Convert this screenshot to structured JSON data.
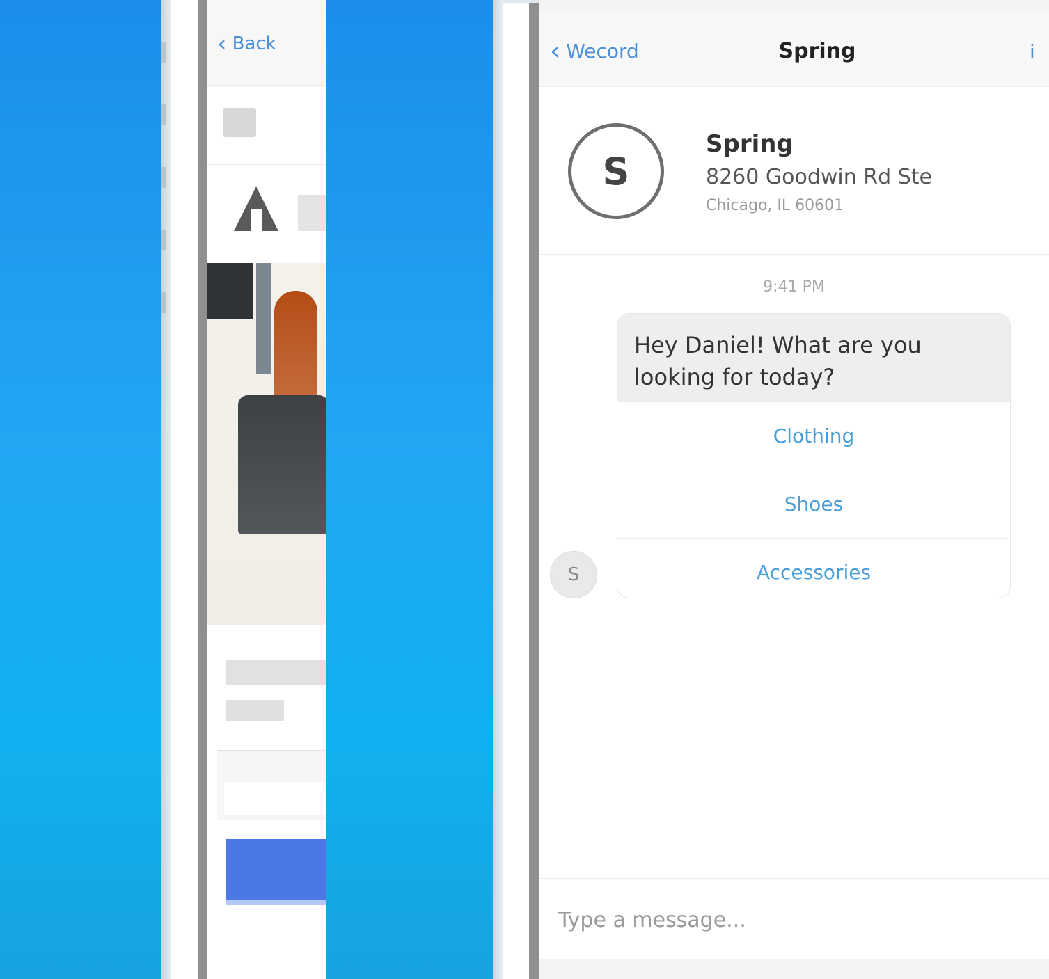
{
  "left_panel": {
    "back_label": "Back"
  },
  "chat": {
    "back_label": "Wecord",
    "title": "Spring",
    "business": {
      "name": "Spring",
      "address": "8260 Goodwin Rd Ste",
      "subtitle": "Chicago, IL 60601"
    },
    "timestamp": "9:41 PM",
    "message": "Hey Daniel! What are you looking for today?",
    "options": [
      "Clothing",
      "Shoes",
      "Accessories"
    ],
    "composer_placeholder": "Type a message..."
  }
}
